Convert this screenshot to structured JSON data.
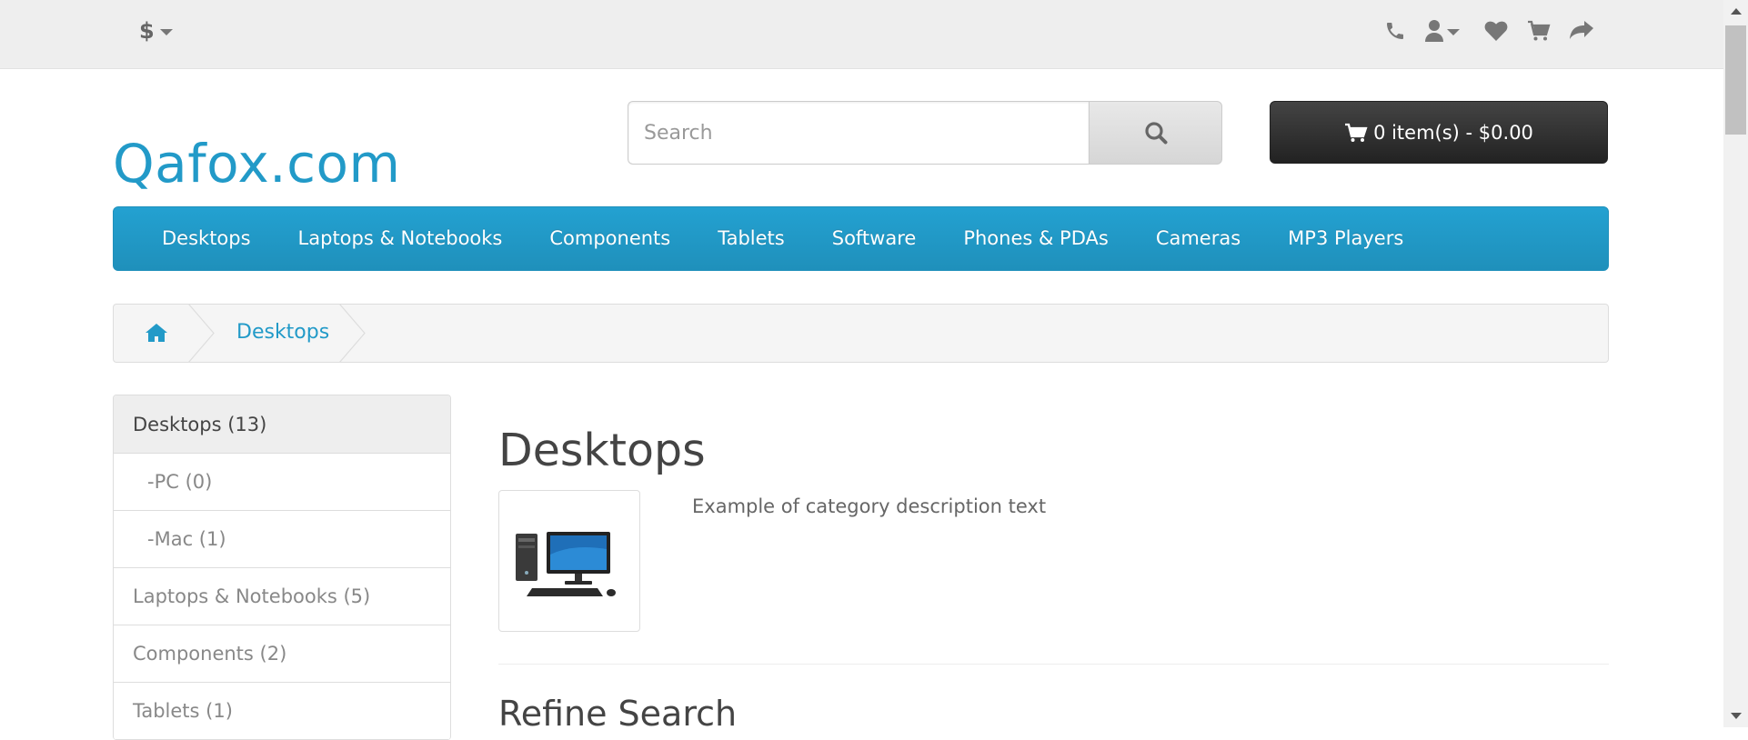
{
  "topbar": {
    "currency_symbol": "$",
    "icons": [
      "phone-icon",
      "user-icon",
      "heart-icon",
      "cart-icon",
      "share-icon"
    ]
  },
  "header": {
    "logo": "Qafox.com",
    "search": {
      "placeholder": "Search",
      "value": ""
    },
    "cart_label": "0 item(s) - $0.00"
  },
  "menu": {
    "items": [
      "Desktops",
      "Laptops & Notebooks",
      "Components",
      "Tablets",
      "Software",
      "Phones & PDAs",
      "Cameras",
      "MP3 Players"
    ]
  },
  "breadcrumb": {
    "current": "Desktops"
  },
  "sidebar": {
    "items": [
      {
        "label": "Desktops (13)"
      },
      {
        "label": "-PC (0)"
      },
      {
        "label": "-Mac (1)"
      },
      {
        "label": "Laptops & Notebooks (5)"
      },
      {
        "label": "Components (2)"
      },
      {
        "label": "Tablets (1)"
      }
    ]
  },
  "main": {
    "title": "Desktops",
    "description": "Example of category description text",
    "refine_heading": "Refine Search"
  },
  "colors": {
    "brand": "#229ac8",
    "menu_bg": "#1f90bb",
    "cart_bg": "#333333"
  }
}
